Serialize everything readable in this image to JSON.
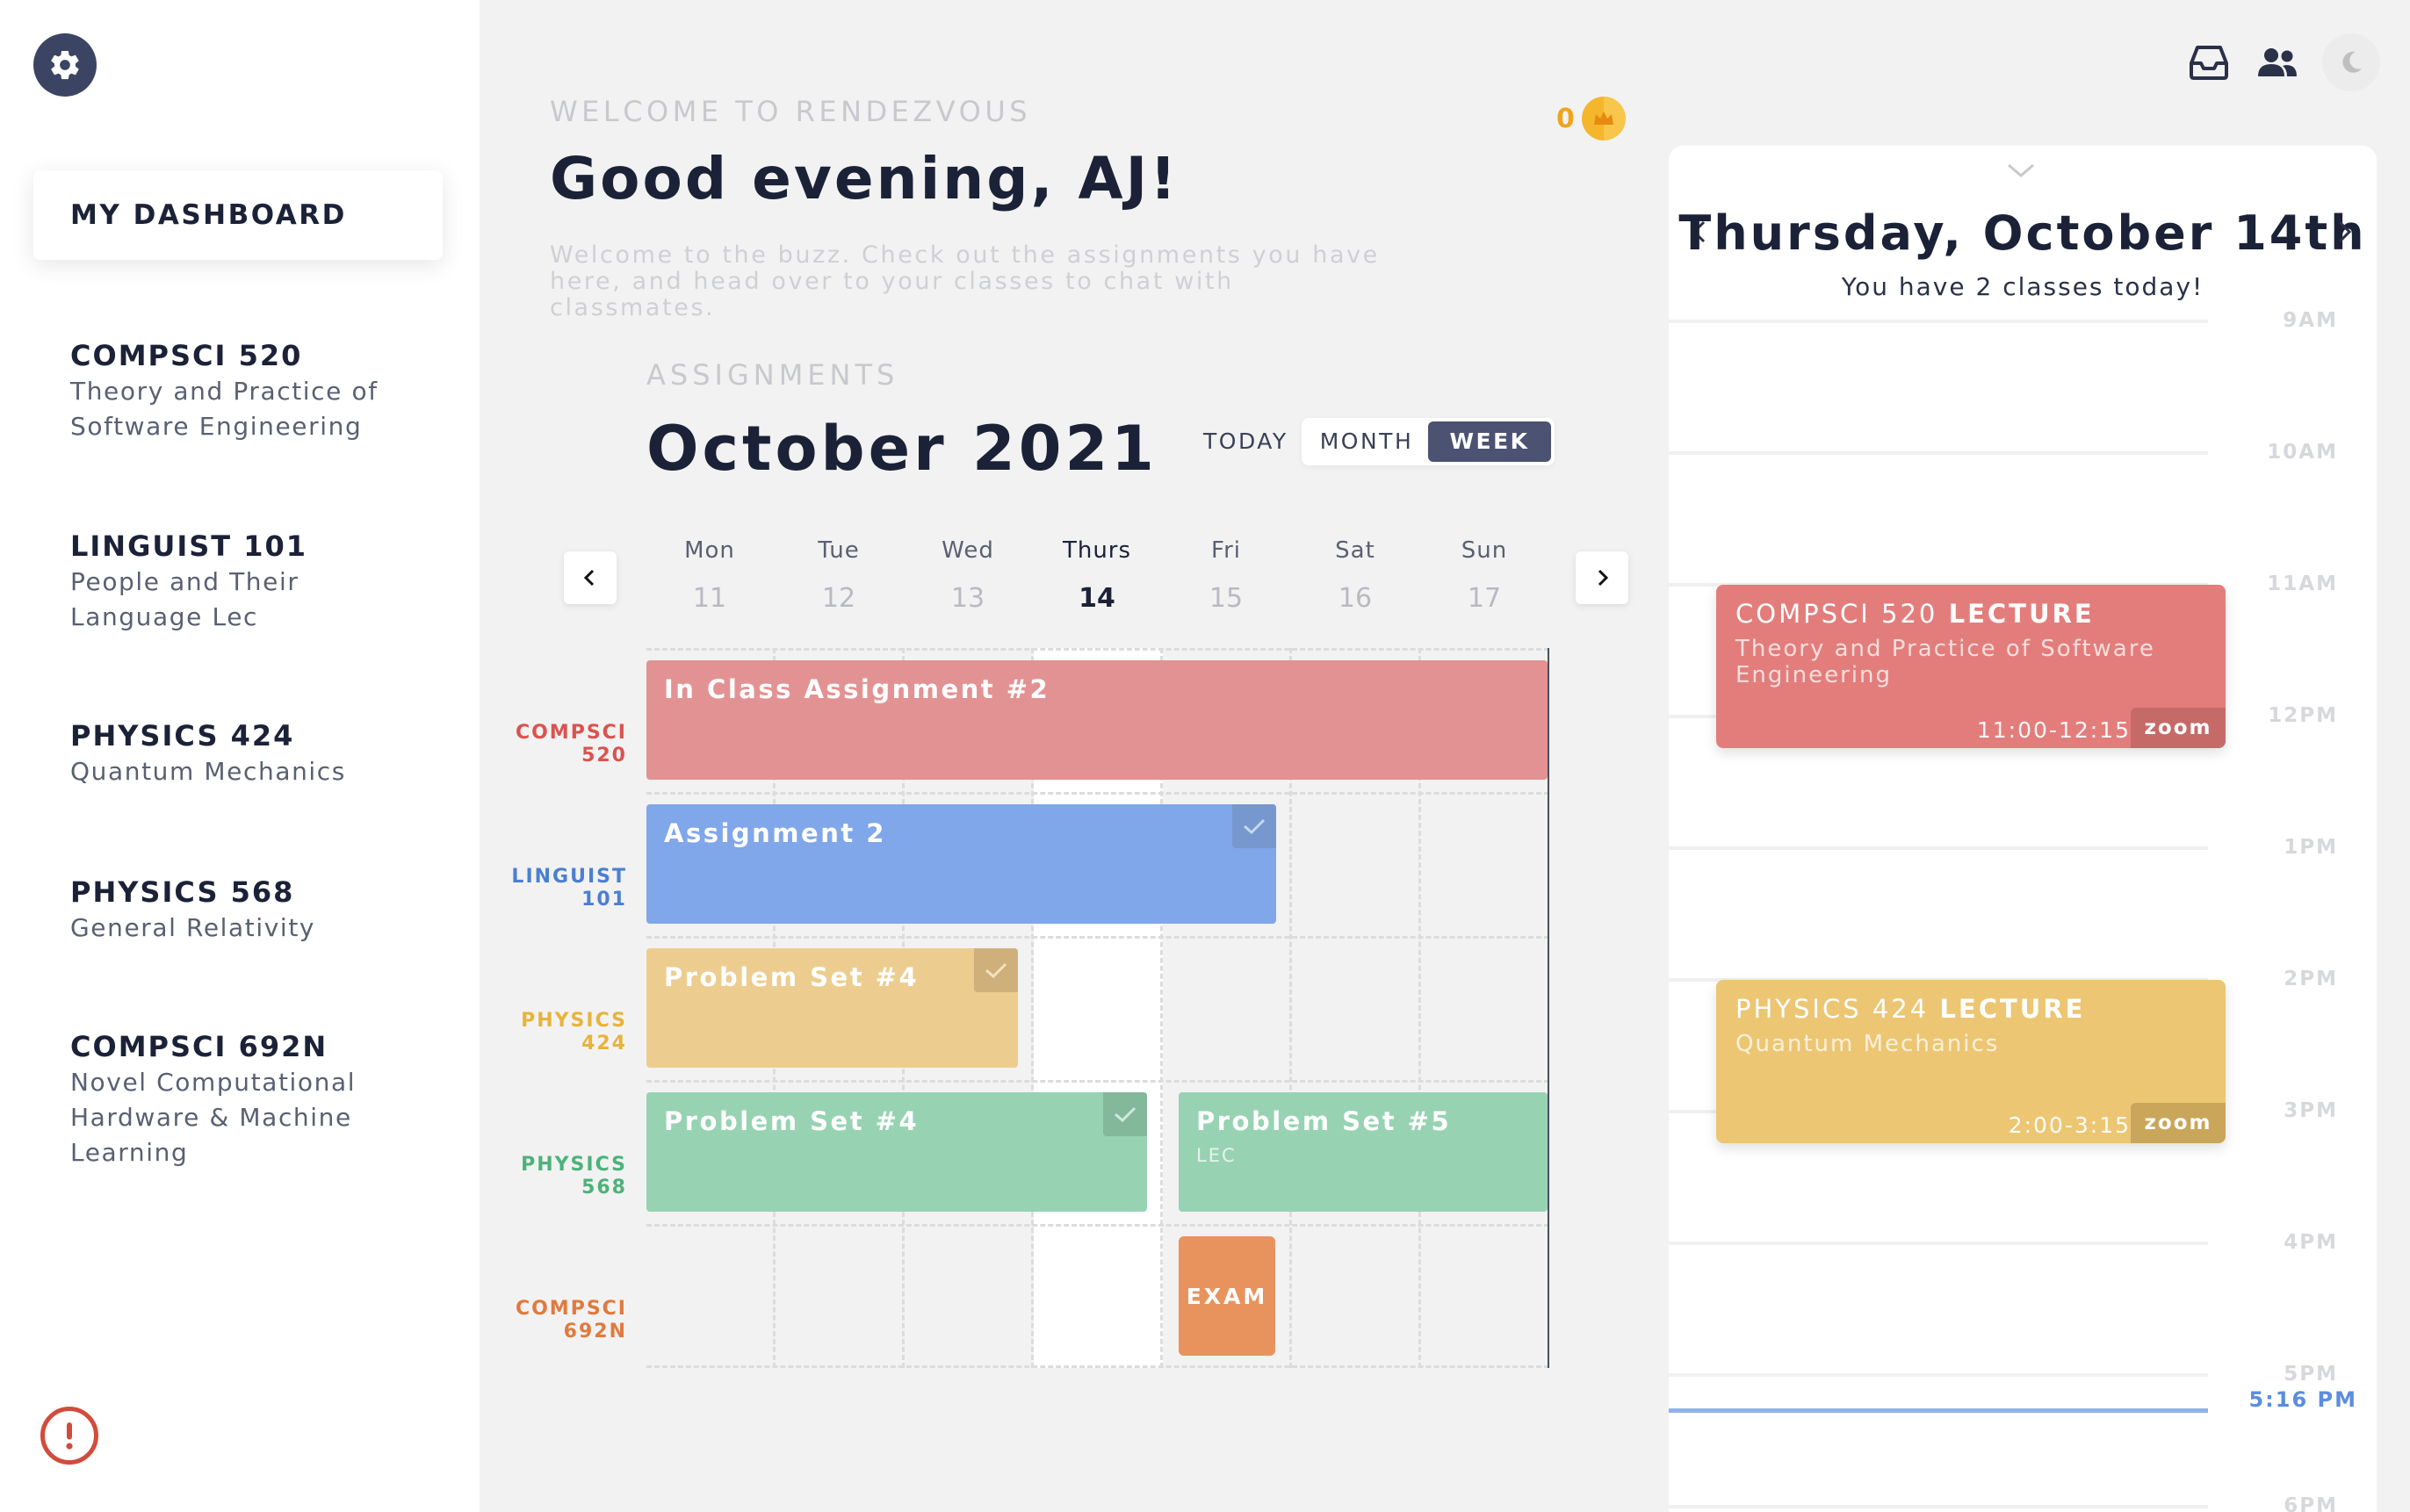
{
  "sidebar": {
    "dashboard_label": "MY DASHBOARD",
    "courses": [
      {
        "code": "COMPSCI 520",
        "name_lines": [
          "Theory and Practice of",
          "Software Engineering"
        ]
      },
      {
        "code": "LINGUIST 101",
        "name_lines": [
          "People and Their",
          "Language Lec"
        ]
      },
      {
        "code": "PHYSICS 424",
        "name_lines": [
          "Quantum Mechanics"
        ]
      },
      {
        "code": "PHYSICS 568",
        "name_lines": [
          "General Relativity"
        ]
      },
      {
        "code": "COMPSCI 692N",
        "name_lines": [
          "Novel Computational",
          "Hardware & Machine",
          "Learning"
        ]
      }
    ],
    "icons": {
      "settings": "gear-icon",
      "alert": "alert-icon"
    }
  },
  "header": {
    "kicker": "WELCOME TO RENDEZVOUS",
    "greeting": "Good evening, AJ!",
    "description": "Welcome to the buzz. Check out the assignments you have here, and head over to your classes to chat with classmates.",
    "coins": "0",
    "top_icons": [
      "inbox-icon",
      "people-icon",
      "moon-icon"
    ]
  },
  "assignments": {
    "kicker": "ASSIGNMENTS",
    "month_title": "October 2021",
    "today_label": "TODAY",
    "view_options": [
      "MONTH",
      "WEEK"
    ],
    "active_view": "WEEK",
    "days": [
      {
        "name": "Mon",
        "num": "11"
      },
      {
        "name": "Tue",
        "num": "12"
      },
      {
        "name": "Wed",
        "num": "13"
      },
      {
        "name": "Thurs",
        "num": "14"
      },
      {
        "name": "Fri",
        "num": "15"
      },
      {
        "name": "Sat",
        "num": "16"
      },
      {
        "name": "Sun",
        "num": "17"
      }
    ],
    "current_day": "Thurs",
    "rows": [
      {
        "line1": "COMPSCI",
        "line2": "520",
        "color": "#d9534f"
      },
      {
        "line1": "LINGUIST",
        "line2": "101",
        "color": "#4a7fd0"
      },
      {
        "line1": "PHYSICS",
        "line2": "424",
        "color": "#e8b33c"
      },
      {
        "line1": "PHYSICS",
        "line2": "568",
        "color": "#4cb27a"
      },
      {
        "line1": "COMPSCI",
        "line2": "692N",
        "color": "#e07a3e"
      }
    ],
    "tasks": [
      {
        "title": "In Class Assignment #2",
        "course": "COMPSCI 520",
        "start_day": "Mon",
        "end_day": "Sun",
        "color": "#e39293"
      },
      {
        "title": "Assignment 2",
        "course": "LINGUIST 101",
        "start_day": "Mon",
        "end_day": "Fri",
        "color": "#80a7ea",
        "completed": true
      },
      {
        "title": "Problem Set #4",
        "course": "PHYSICS 424",
        "start_day": "Mon",
        "end_day": "Wed",
        "color": "#edcd8f",
        "completed": true
      },
      {
        "title": "Problem Set #4",
        "course": "PHYSICS 568",
        "start_day": "Mon",
        "end_day": "Thurs",
        "color": "#97d3b2",
        "completed": true
      },
      {
        "title": "Problem Set #5",
        "subtitle": "LEC",
        "course": "PHYSICS 568",
        "start_day": "Fri",
        "end_day": "Sun",
        "color": "#97d3b2"
      },
      {
        "title": "EXAM",
        "course": "COMPSCI 692N",
        "start_day": "Fri",
        "end_day": "Fri",
        "color": "#e8935e"
      }
    ]
  },
  "day_panel": {
    "date_title": "Thursday, October 14th",
    "subtitle": "You have 2 classes today!",
    "hours": [
      "9AM",
      "10AM",
      "11AM",
      "12PM",
      "1PM",
      "2PM",
      "3PM",
      "4PM",
      "5PM",
      "6PM"
    ],
    "now_label": "5:16 PM",
    "events": [
      {
        "title_course": "COMPSCI 520",
        "title_kind": "LECTURE",
        "description": "Theory and Practice of Software Engineering",
        "time": "11:00-12:15",
        "link": "zoom",
        "color": "#e37d7b",
        "zoom_color": "#c66a67"
      },
      {
        "title_course": "PHYSICS 424",
        "title_kind": "LECTURE",
        "description": "Quantum Mechanics",
        "time": "2:00-3:15",
        "link": "zoom",
        "color": "#ecc673",
        "zoom_color": "#c9a65a"
      }
    ]
  }
}
